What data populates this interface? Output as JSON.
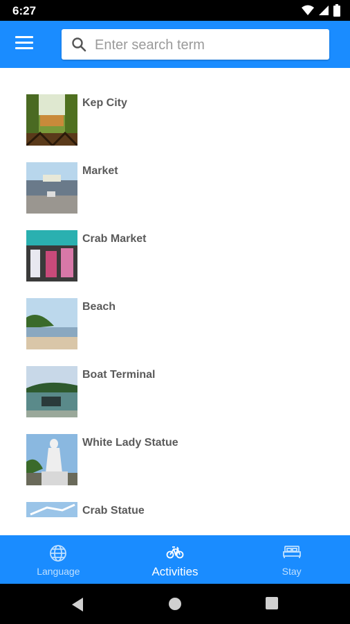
{
  "status_bar": {
    "time": "6:27",
    "icons": [
      "wifi-icon",
      "signal-icon",
      "battery-icon"
    ]
  },
  "app_bar": {
    "menu_icon": "hamburger-menu-icon",
    "search_icon": "search-icon",
    "search_placeholder": "Enter search term",
    "search_value": ""
  },
  "colors": {
    "primary": "#1a8cff",
    "nav_inactive": "#bfe0ff",
    "item_text": "#5a5a5a"
  },
  "activities": [
    {
      "label": "Kep City"
    },
    {
      "label": "Market"
    },
    {
      "label": "Crab Market"
    },
    {
      "label": "Beach"
    },
    {
      "label": "Boat Terminal"
    },
    {
      "label": "White Lady Statue"
    },
    {
      "label": "Crab Statue"
    }
  ],
  "bottom_nav": [
    {
      "label": "Language",
      "icon": "globe-icon",
      "active": false
    },
    {
      "label": "Activities",
      "icon": "bicycle-icon",
      "active": true
    },
    {
      "label": "Stay",
      "icon": "bed-icon",
      "active": false
    }
  ],
  "system_nav": [
    "back-icon",
    "home-icon",
    "recents-icon"
  ]
}
